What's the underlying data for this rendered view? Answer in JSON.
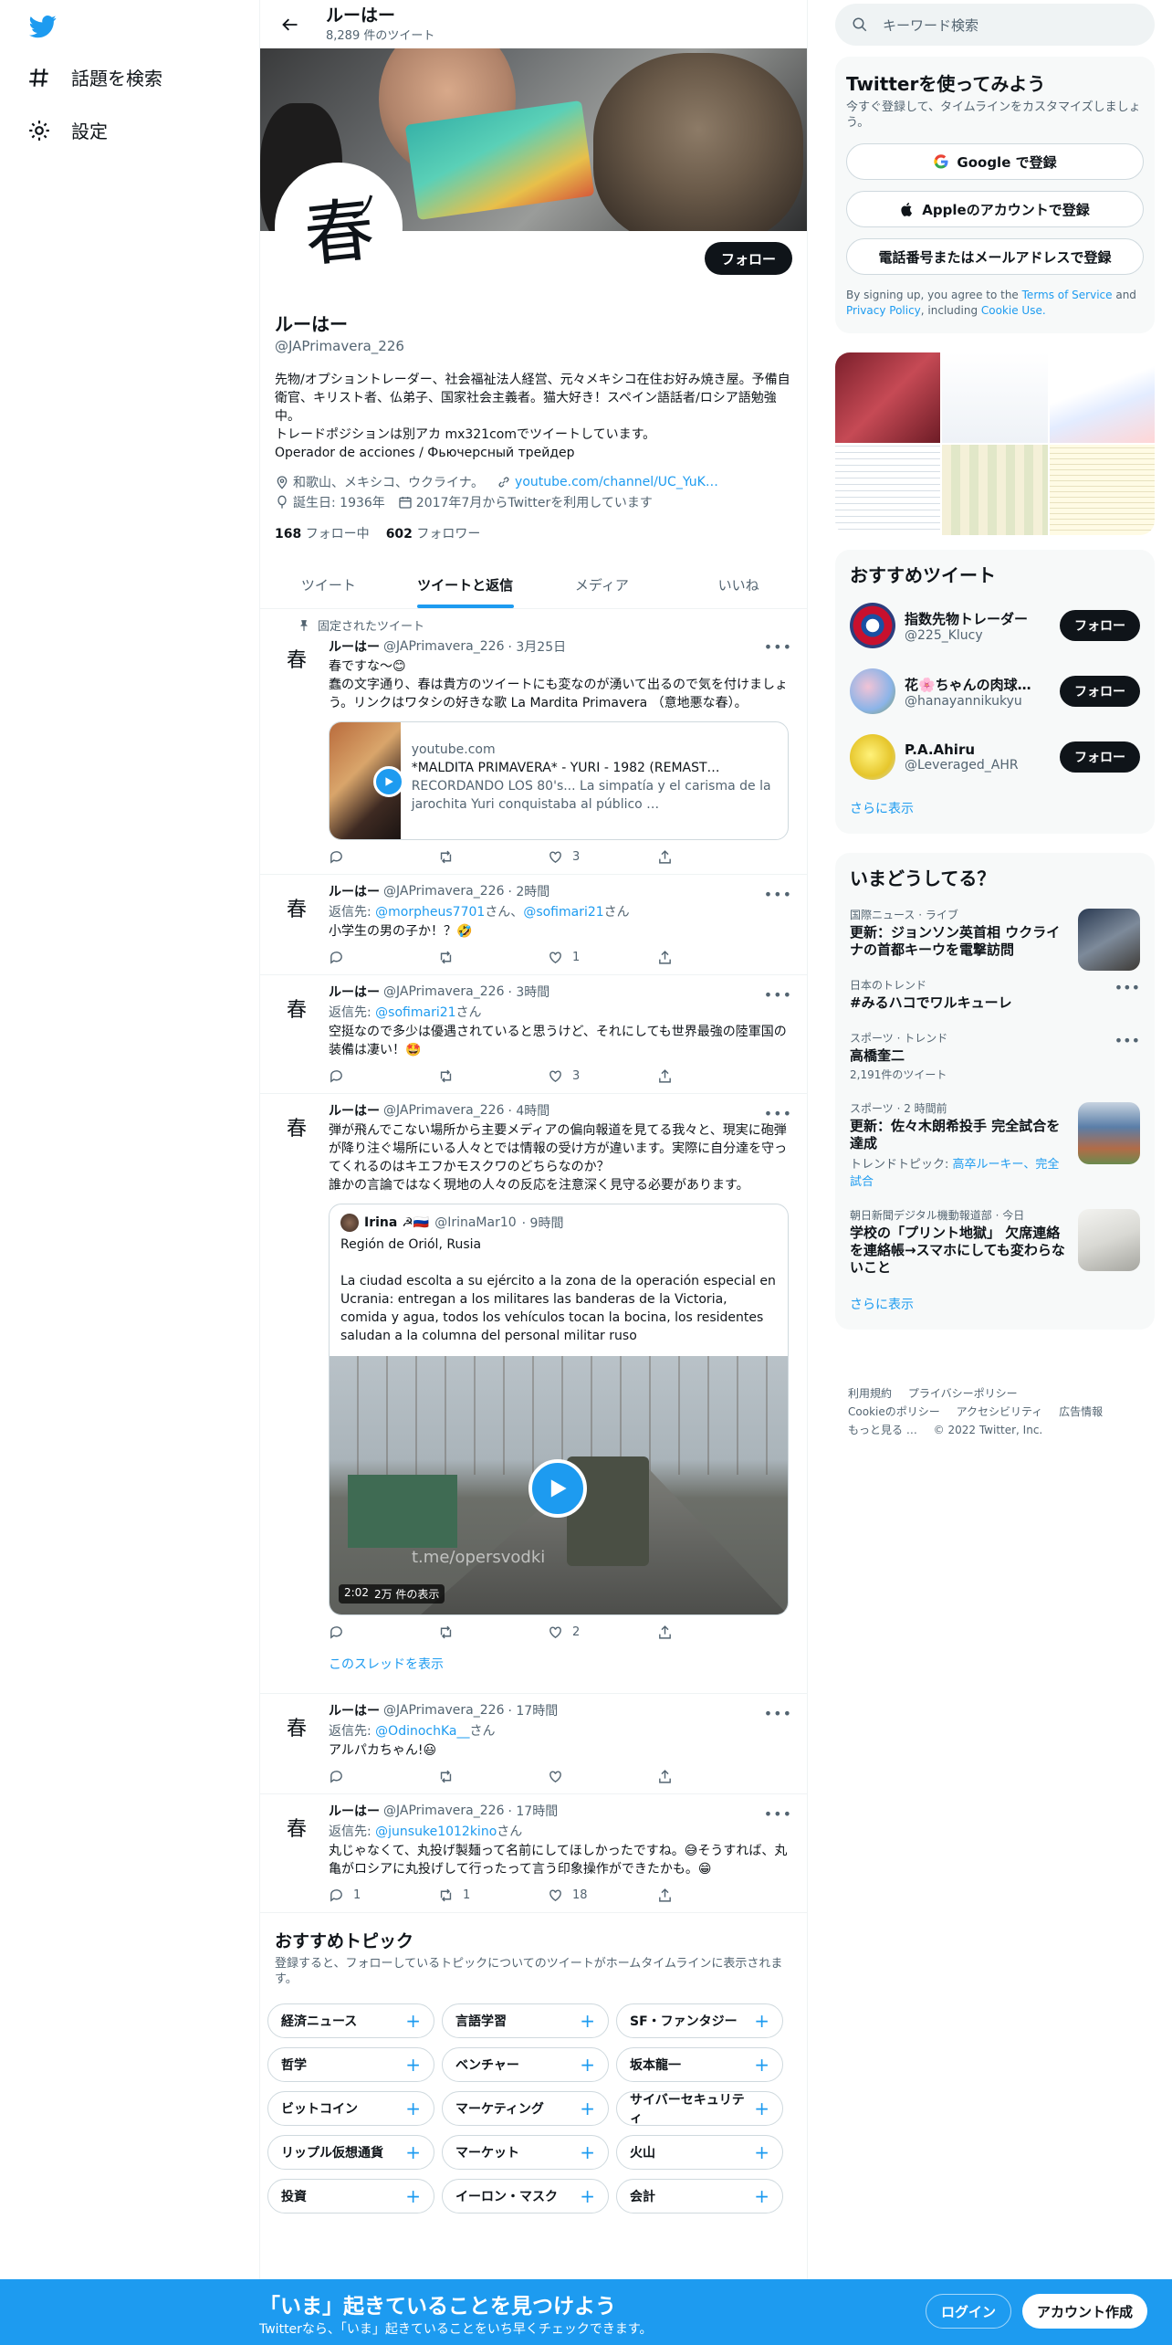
{
  "nav": {
    "explore_label": "話題を検索",
    "settings_label": "設定"
  },
  "header": {
    "name": "ルーはー",
    "tweet_count": "8,289 件のツイート"
  },
  "profile": {
    "avatar_text": "春",
    "avatar_kana": "ノ",
    "name": "ルーはー",
    "handle": "@JAPrimavera_226",
    "follow_label": "フォロー",
    "bio": "先物/オプショントレーダー、社会福祉法人経営、元々メキシコ在住お好み焼き屋。予備自衛官、キリスト者、仏弟子、国家社会主義者。猫大好き！スペイン語話者/ロシア語勉強中。\nトレードポジションは別アカ mx321comでツイートしています。\nOperador de acciones / Фьючерсный трейдер",
    "location": "和歌山、メキシコ、ウクライナ。",
    "url": "youtube.com/channel/UC_YuK…",
    "birth": "誕生日: 1936年",
    "joined": "2017年7月からTwitterを利用しています",
    "following_count": "168",
    "following_label": "フォロー中",
    "followers_count": "602",
    "followers_label": "フォロワー"
  },
  "tabs": [
    "ツイート",
    "ツイートと返信",
    "メディア",
    "いいね"
  ],
  "active_tab": 1,
  "tweets": [
    {
      "pinned_label": "固定されたツイート",
      "name": "ルーはー",
      "handle": "@JAPrimavera_226",
      "time": "· 3月25日",
      "body": "春ですな～😊\n蠢の文字通り、春は貴方のツイートにも変なのが湧いて出るので気を付けましょう。リンクはワタシの好きな歌 La Mardita Primavera （意地悪な春）。",
      "card": {
        "domain": "youtube.com",
        "title": "*MALDITA PRIMAVERA* - YURI - 1982 (REMAST…",
        "desc": "RECORDANDO LOS 80's... La simpatía y el carisma de la jarochita Yuri conquistaba al público …"
      },
      "replies": "",
      "retweets": "",
      "likes": "3"
    },
    {
      "name": "ルーはー",
      "handle": "@JAPrimavera_226",
      "time": "· 2時間",
      "reply_prefix": "返信先: ",
      "reply_to_1": "@morpheus7701",
      "reply_mid": "さん、",
      "reply_to_2": "@sofimari21",
      "reply_suffix": "さん",
      "body": "小学生の男の子か！？🤣",
      "replies": "",
      "retweets": "",
      "likes": "1"
    },
    {
      "name": "ルーはー",
      "handle": "@JAPrimavera_226",
      "time": "· 3時間",
      "reply_prefix": "返信先: ",
      "reply_to_1": "@sofimari21",
      "reply_suffix": "さん",
      "body": "空挺なので多少は優遇されていると思うけど、それにしても世界最強の陸軍国の装備は凄い！🤩",
      "replies": "",
      "retweets": "",
      "likes": "3"
    },
    {
      "name": "ルーはー",
      "handle": "@JAPrimavera_226",
      "time": "· 4時間",
      "body": "弾が飛んでこない場所から主要メディアの偏向報道を見てる我々と、現実に砲弾が降り注ぐ場所にいる人々とでは情報の受け方が違います。実際に自分達を守ってくれるのはキエフかモスクワのどちらなのか？\n誰かの言論ではなく現地の人々の反応を注意深く見守る必要があります。",
      "quote": {
        "name": "Irina ☭🇷🇺",
        "handle": "@IrinaMar10",
        "time": "· 9時間",
        "body": "Región de Oriól, Rusia\n\nLa ciudad escolta a su ejército a la zona de la operación especial en Ucrania: entregan a los militares las banderas de la Victoria, comida y agua, todos los vehículos tocan la bocina, los residentes saludan a la columna del personal militar ruso",
        "watermark": "t.me/opersvodki",
        "duration": "2:02",
        "views": "2万 件の表示"
      },
      "replies": "",
      "retweets": "",
      "likes": "2",
      "thread_link": "このスレッドを表示"
    },
    {
      "name": "ルーはー",
      "handle": "@JAPrimavera_226",
      "time": "· 17時間",
      "reply_prefix": "返信先: ",
      "reply_to_1": "@OdinochKa__",
      "reply_suffix": "さん",
      "body": "アルパカちゃん!😃",
      "replies": "",
      "retweets": "",
      "likes": ""
    },
    {
      "name": "ルーはー",
      "handle": "@JAPrimavera_226",
      "time": "· 17時間",
      "reply_prefix": "返信先: ",
      "reply_to_1": "@junsuke1012kino",
      "reply_suffix": "さん",
      "body": "丸じゃなくて、丸投げ製麺って名前にしてほしかったですね。😅そうすれば、丸亀がロシアに丸投げして行ったって言う印象操作ができたかも。😁",
      "replies": "1",
      "retweets": "1",
      "likes": "18"
    }
  ],
  "topics": {
    "title": "おすすめトピック",
    "subtitle": "登録すると、フォローしているトピックについてのツイートがホームタイムラインに表示されます。",
    "items": [
      "経済ニュース",
      "言語学習",
      "SF・ファンタジー",
      "哲学",
      "ベンチャー",
      "坂本龍一",
      "ビットコイン",
      "マーケティング",
      "サイバーセキュリティ",
      "リップル仮想通貨",
      "マーケット",
      "火山",
      "投資",
      "イーロン・マスク",
      "会計"
    ]
  },
  "search": {
    "placeholder": "キーワード検索"
  },
  "signup": {
    "title": "Twitterを使ってみよう",
    "subtitle": "今すぐ登録して、タイムラインをカスタマイズしましょう。",
    "google_label": "Google で登録",
    "apple_label": "Appleのアカウントで登録",
    "phone_label": "電話番号またはメールアドレスで登録",
    "legal_prefix": "By signing up, you agree to the ",
    "terms": "Terms of Service",
    "and": " and ",
    "privacy": "Privacy Policy",
    "including": ", including ",
    "cookie": "Cookie Use."
  },
  "recommended": {
    "title": "おすすめツイート",
    "follow_label": "フォロー",
    "users": [
      {
        "name": "指数先物トレーダー",
        "handle": "@225_Klucy"
      },
      {
        "name": "花🌸ちゃんの肉球…",
        "handle": "@hanayannikukyu"
      },
      {
        "name": "P.A.Ahiru",
        "handle": "@Leveraged_AHR"
      }
    ],
    "more_label": "さらに表示"
  },
  "trends": {
    "title": "いまどうしてる？",
    "items": [
      {
        "category": "国際ニュース · ライブ",
        "title": "更新：ジョンソン英首相 ウクライナの首都キーウを電撃訪問"
      },
      {
        "category": "日本のトレンド",
        "title": "#みるハコでワルキューレ"
      },
      {
        "category": "スポーツ · トレンド",
        "title": "高橋奎二",
        "count": "2,191件のツイート"
      },
      {
        "category": "スポーツ · 2 時間前",
        "title": "更新：佐々木朗希投手 完全試合を達成",
        "topic_prefix": "トレンドトピック: ",
        "topic_links": "高卒ルーキー、完全試合"
      },
      {
        "category": "朝日新聞デジタル機動報道部 · 今日",
        "title": "学校の「プリント地獄」 欠席連絡を連絡帳→スマホにしても変わらないこと"
      }
    ],
    "more_label": "さらに表示"
  },
  "footer": {
    "links": [
      "利用規約",
      "プライバシーポリシー",
      "Cookieのポリシー",
      "アクセシビリティ",
      "広告情報",
      "もっと見る …"
    ],
    "copyright": "© 2022 Twitter, Inc."
  },
  "bottombar": {
    "title": "「いま」起きていることを見つけよう",
    "subtitle": "Twitterなら、「いま」起きていることをいち早くチェックできます。",
    "login_label": "ログイン",
    "signup_label": "アカウント作成"
  },
  "colors": {
    "accent": "#1d9bf0",
    "text": "#0f1419",
    "secondary": "#536471"
  }
}
